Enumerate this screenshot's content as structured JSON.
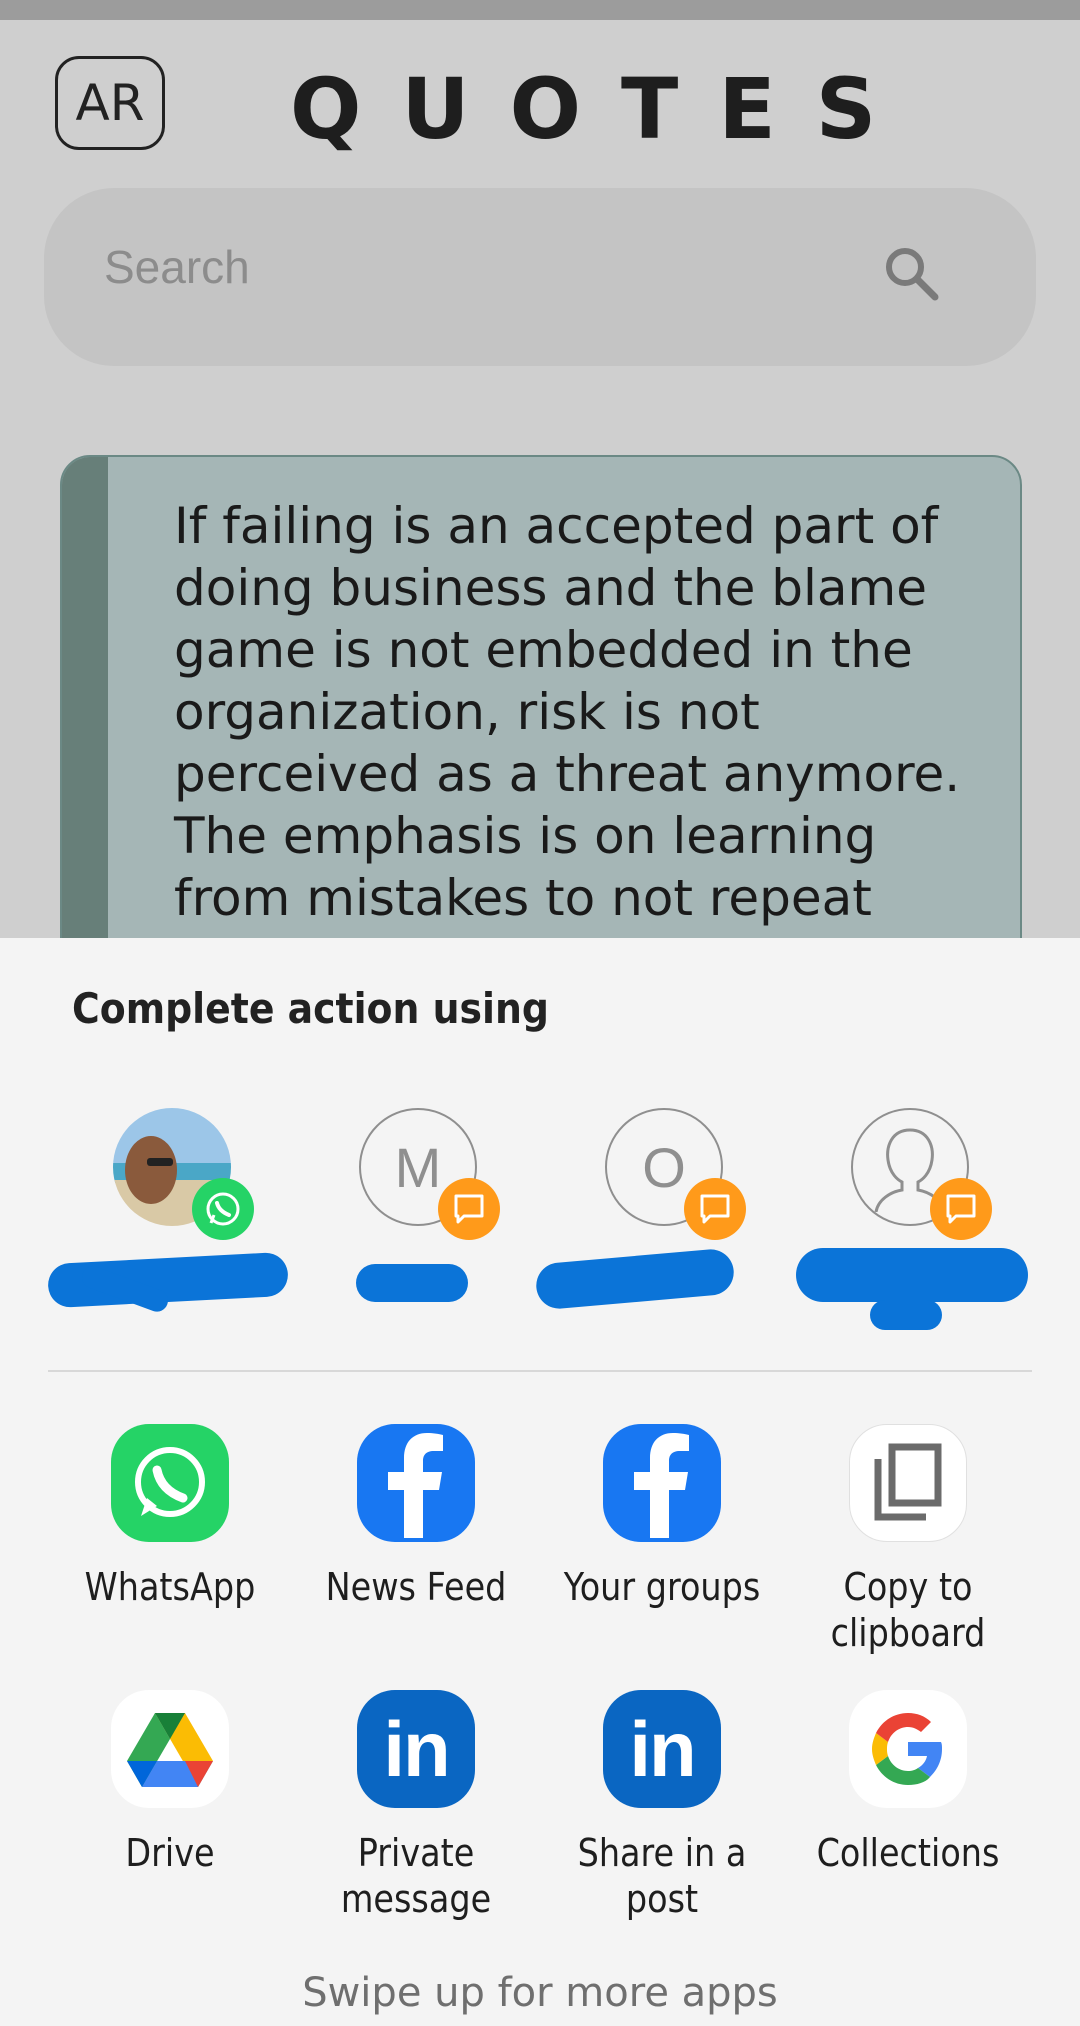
{
  "header": {
    "lang_button": "AR",
    "title": "QUOTES"
  },
  "search": {
    "placeholder": "Search"
  },
  "quote": {
    "text": "If failing is an accepted part of doing business and the blame game is not embedded in the organization, risk is not perceived as a threat anymore. The emphasis is on learning from mistakes to not repeat them"
  },
  "share_sheet": {
    "title": "Complete action using",
    "contacts": [
      {
        "initial": "",
        "badge": "whatsapp-icon"
      },
      {
        "initial": "M",
        "badge": "message-icon"
      },
      {
        "initial": "O",
        "badge": "message-icon"
      },
      {
        "initial": "",
        "badge": "message-icon"
      }
    ],
    "apps": [
      {
        "label": "WhatsApp",
        "icon": "whatsapp-icon"
      },
      {
        "label": "News Feed",
        "icon": "facebook-icon"
      },
      {
        "label": "Your groups",
        "icon": "facebook-icon"
      },
      {
        "label": "Copy to clipboard",
        "icon": "copy-icon"
      },
      {
        "label": "Drive",
        "icon": "drive-icon"
      },
      {
        "label": "Private message",
        "icon": "linkedin-icon"
      },
      {
        "label": "Share in a post",
        "icon": "linkedin-icon"
      },
      {
        "label": "Collections",
        "icon": "google-icon"
      }
    ],
    "footer": "Swipe up for more apps"
  },
  "colors": {
    "background": "#cfcfcf",
    "quote_card": "#a5b6b6",
    "quote_accent": "#677f79",
    "sheet": "#f4f4f4",
    "whatsapp_green": "#25d366",
    "facebook_blue": "#1877f2",
    "linkedin_blue": "#0a66c2",
    "badge_orange": "#ff9a1a"
  }
}
